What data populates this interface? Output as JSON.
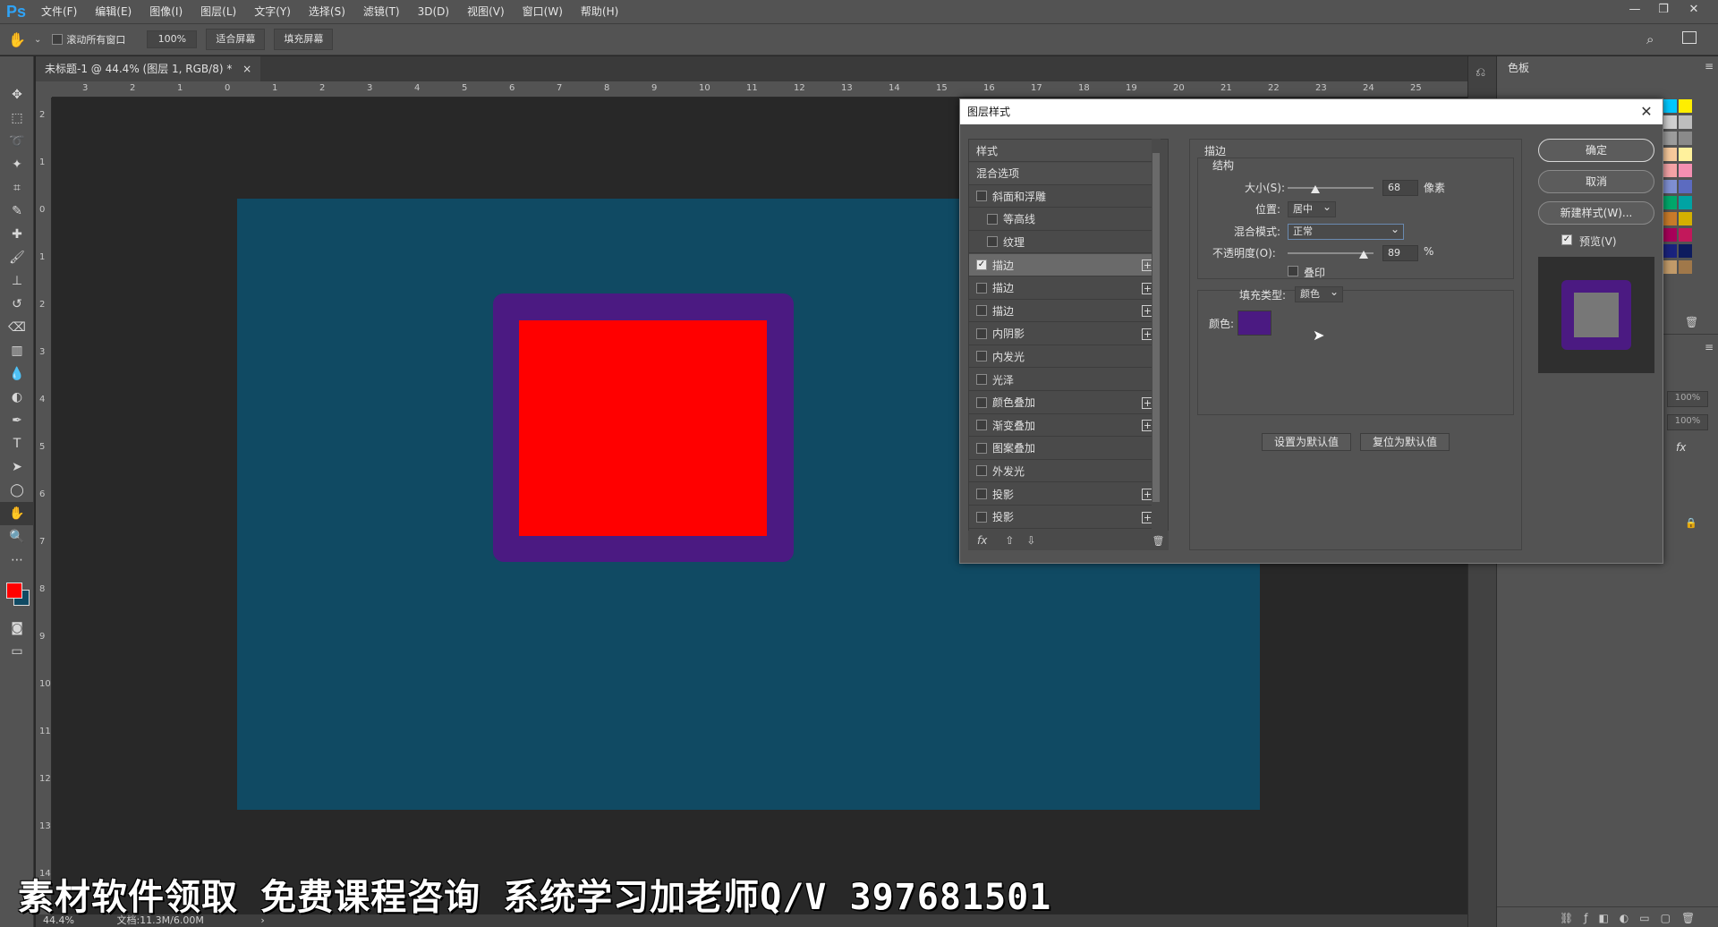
{
  "app": {
    "logo": "Ps",
    "menus": [
      "文件(F)",
      "编辑(E)",
      "图像(I)",
      "图层(L)",
      "文字(Y)",
      "选择(S)",
      "滤镜(T)",
      "3D(D)",
      "视图(V)",
      "窗口(W)",
      "帮助(H)"
    ],
    "window_controls": [
      "—",
      "❐",
      "✕"
    ]
  },
  "options_bar": {
    "scroll_all_label": "滚动所有窗口",
    "zoom_value": "100%",
    "fit_screen": "适合屏幕",
    "fill_screen": "填充屏幕"
  },
  "document": {
    "tab_title": "未标题-1 @ 44.4% (图层 1, RGB/8) *",
    "tab_close": "×",
    "h_ruler": [
      "3",
      "2",
      "1",
      "0",
      "1",
      "2",
      "3",
      "4",
      "5",
      "6",
      "7",
      "8",
      "9",
      "10",
      "11",
      "12",
      "13",
      "14",
      "15",
      "16",
      "17",
      "18",
      "19",
      "20",
      "21",
      "22",
      "23",
      "24",
      "25"
    ],
    "v_ruler": [
      "2",
      "1",
      "0",
      "1",
      "2",
      "3",
      "4",
      "5",
      "6",
      "7",
      "8",
      "9",
      "10",
      "11",
      "12",
      "13",
      "14"
    ],
    "status_zoom": "44.4%",
    "status_doc": "文档:11.3M/6.00M",
    "colors": {
      "canvas": "#104a63",
      "stroke": "#4b1a82",
      "fill": "#ff0000"
    }
  },
  "right_panel": {
    "tab_swatches": "色板",
    "opacity_a": "100%",
    "opacity_b": "100%",
    "fx": "fx"
  },
  "dialog": {
    "title": "图层样式",
    "close": "✕",
    "style_list": [
      {
        "label": "样式",
        "checkbox": false,
        "plus": false,
        "header": true
      },
      {
        "label": "混合选项",
        "checkbox": false,
        "plus": false,
        "header": true
      },
      {
        "label": "斜面和浮雕",
        "checkbox": true,
        "checked": false,
        "plus": false
      },
      {
        "label": "等高线",
        "checkbox": true,
        "checked": false,
        "plus": false,
        "indent": true
      },
      {
        "label": "纹理",
        "checkbox": true,
        "checked": false,
        "plus": false,
        "indent": true
      },
      {
        "label": "描边",
        "checkbox": true,
        "checked": true,
        "plus": true,
        "selected": true
      },
      {
        "label": "描边",
        "checkbox": true,
        "checked": false,
        "plus": true
      },
      {
        "label": "描边",
        "checkbox": true,
        "checked": false,
        "plus": true
      },
      {
        "label": "内阴影",
        "checkbox": true,
        "checked": false,
        "plus": true
      },
      {
        "label": "内发光",
        "checkbox": true,
        "checked": false,
        "plus": false
      },
      {
        "label": "光泽",
        "checkbox": true,
        "checked": false,
        "plus": false
      },
      {
        "label": "颜色叠加",
        "checkbox": true,
        "checked": false,
        "plus": true
      },
      {
        "label": "渐变叠加",
        "checkbox": true,
        "checked": false,
        "plus": true
      },
      {
        "label": "图案叠加",
        "checkbox": true,
        "checked": false,
        "plus": false
      },
      {
        "label": "外发光",
        "checkbox": true,
        "checked": false,
        "plus": false
      },
      {
        "label": "投影",
        "checkbox": true,
        "checked": false,
        "plus": true
      },
      {
        "label": "投影",
        "checkbox": true,
        "checked": false,
        "plus": true
      }
    ],
    "footer": {
      "fx": "fx",
      "up": "⇧",
      "down": "⇩",
      "trash": "🗑"
    },
    "stroke": {
      "section": "描边",
      "structure": "结构",
      "size_label": "大小(S):",
      "size_value": "68",
      "size_unit": "像素",
      "position_label": "位置:",
      "position_value": "居中",
      "blend_label": "混合模式:",
      "blend_value": "正常",
      "opacity_label": "不透明度(O):",
      "opacity_value": "89",
      "opacity_unit": "%",
      "overprint_label": "叠印",
      "fill_type_label": "填充类型:",
      "fill_type_value": "颜色",
      "color_label": "颜色:",
      "color_value": "#4b1a82",
      "set_default": "设置为默认值",
      "reset_default": "复位为默认值"
    },
    "buttons": {
      "ok": "确定",
      "cancel": "取消",
      "new_style": "新建样式(W)...",
      "preview": "预览(V)"
    }
  },
  "watermark": "素材软件领取 免费课程咨询 系统学习加老师Q/V 397681501"
}
